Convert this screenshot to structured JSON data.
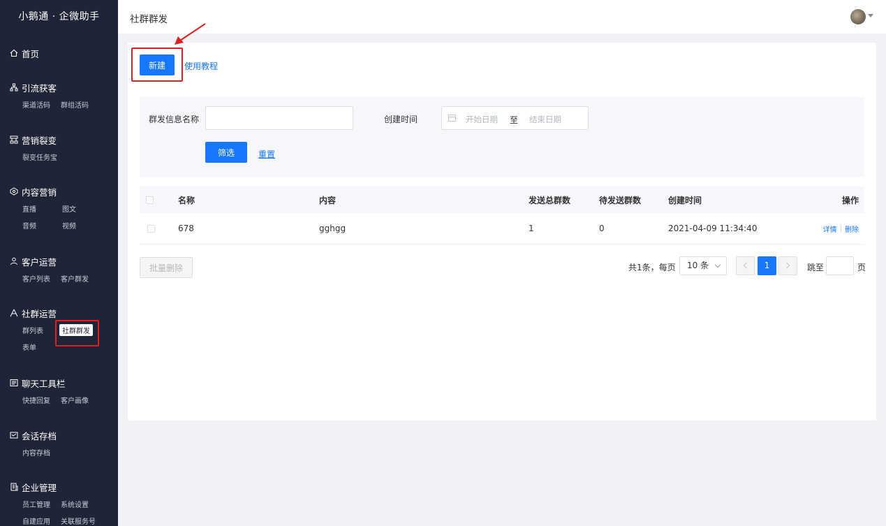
{
  "app": {
    "brand": "小鹅通 · 企微助手"
  },
  "topbar": {
    "title": "社群群发"
  },
  "sidebar": {
    "groups": [
      {
        "label": "首页",
        "icon": "home-icon",
        "subs": []
      },
      {
        "label": "引流获客",
        "icon": "network-icon",
        "subs": [
          [
            "渠道活码",
            "群组活码"
          ]
        ]
      },
      {
        "label": "营销裂变",
        "icon": "sitemap-icon",
        "subs": [
          [
            "裂变任务宝"
          ]
        ]
      },
      {
        "label": "内容营销",
        "icon": "content-icon",
        "subs": [
          [
            "直播",
            "图文"
          ],
          [
            "音频",
            "视频"
          ]
        ]
      },
      {
        "label": "客户运营",
        "icon": "user-icon",
        "subs": [
          [
            "客户列表",
            "客户群发"
          ]
        ]
      },
      {
        "label": "社群运营",
        "icon": "community-icon",
        "subs": [
          [
            "群列表",
            "社群群发"
          ],
          [
            "表单"
          ]
        ]
      },
      {
        "label": "聊天工具栏",
        "icon": "chat-tool-icon",
        "subs": [
          [
            "快捷回复",
            "客户画像"
          ]
        ]
      },
      {
        "label": "会话存档",
        "icon": "archive-icon",
        "subs": [
          [
            "内容存档"
          ]
        ]
      },
      {
        "label": "企业管理",
        "icon": "building-icon",
        "subs": [
          [
            "员工管理",
            "系统设置"
          ],
          [
            "自建应用",
            "关联服务号"
          ]
        ]
      }
    ],
    "active_sub": "社群群发"
  },
  "actions": {
    "new_label": "新建",
    "tutorial_label": "使用教程"
  },
  "filter": {
    "name_label": "群发信息名称",
    "name_value": "",
    "time_label": "创建时间",
    "start_placeholder": "开始日期",
    "range_sep": "至",
    "end_placeholder": "结束日期",
    "filter_btn": "筛选",
    "reset_link": "重置"
  },
  "table": {
    "columns": [
      "名称",
      "内容",
      "发送总群数",
      "待发送群数",
      "创建时间",
      "操作"
    ],
    "rows": [
      {
        "name": "678",
        "content": "gghgg",
        "total": "1",
        "pending": "0",
        "created": "2021-04-09 11:34:40",
        "op_detail": "详情",
        "op_delete": "删除"
      }
    ]
  },
  "footer": {
    "batch_delete": "批量删除",
    "total_text": "共1条，每页",
    "page_size": "10 条",
    "current_page": "1",
    "jump_label": "跳至",
    "page_unit": "页"
  },
  "colors": {
    "sidebar_bg": "#1f2437",
    "primary": "#1677ff",
    "highlight": "#e02020"
  }
}
